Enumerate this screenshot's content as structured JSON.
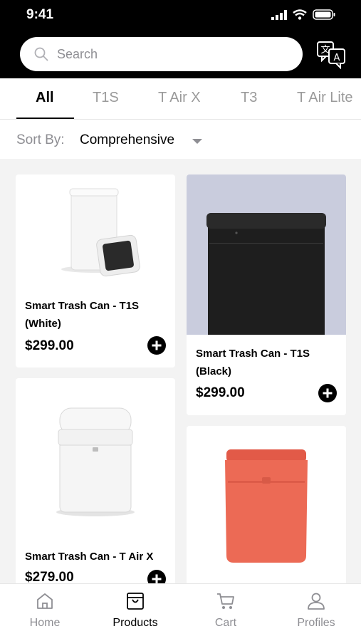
{
  "status_bar": {
    "time": "9:41"
  },
  "search": {
    "placeholder": "Search"
  },
  "tabs": [
    {
      "label": "All",
      "active": true
    },
    {
      "label": "T1S"
    },
    {
      "label": "T Air X"
    },
    {
      "label": "T3"
    },
    {
      "label": "T Air Lite"
    }
  ],
  "sort": {
    "label": "Sort By:",
    "value": "Comprehensive"
  },
  "products": [
    {
      "name": "Smart Trash Can - T1S (White)",
      "price": "$299.00"
    },
    {
      "name": "Smart Trash Can - T1S (Black)",
      "price": "$299.00"
    },
    {
      "name": "Smart Trash Can - T Air X",
      "price": "$279.00"
    },
    {
      "name": "",
      "price": ""
    }
  ],
  "bottom_nav": [
    {
      "label": "Home",
      "icon": "home-icon"
    },
    {
      "label": "Products",
      "icon": "bag-icon",
      "active": true
    },
    {
      "label": "Cart",
      "icon": "cart-icon"
    },
    {
      "label": "Profiles",
      "icon": "user-icon"
    }
  ],
  "colors": {
    "accent": "#000000",
    "inactive": "#8e8e93",
    "background": "#f3f3f3",
    "coral_product": "#e8604d"
  }
}
